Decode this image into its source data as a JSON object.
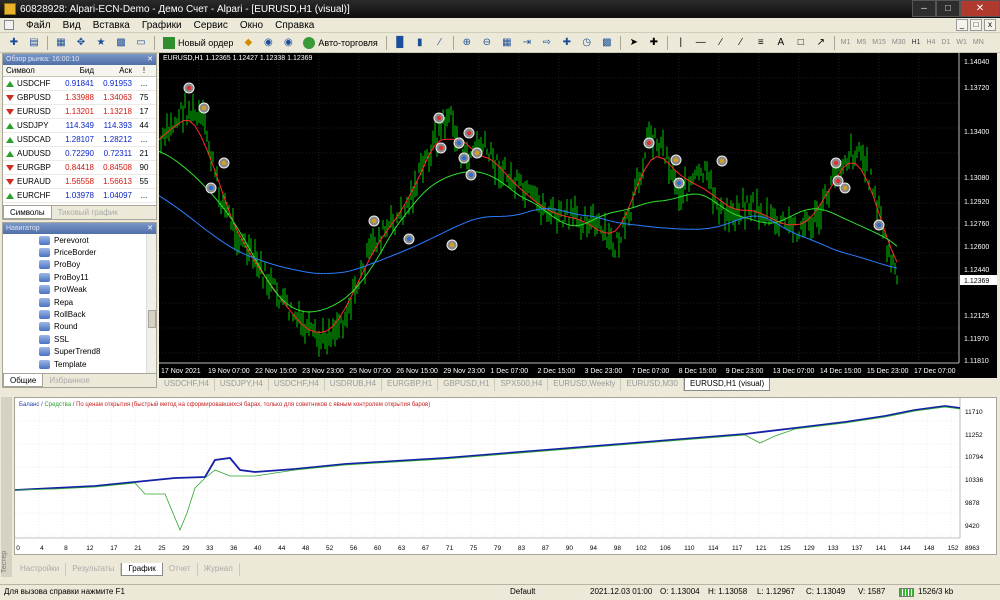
{
  "window": {
    "title": "60828928: Alpari-ECN-Demo - Демо Счет - Alpari - [EURUSD,H1 (visual)]"
  },
  "menu": [
    "Файл",
    "Вид",
    "Вставка",
    "Графики",
    "Сервис",
    "Окно",
    "Справка"
  ],
  "toolbar": {
    "new_order_label": "Новый ордер",
    "autotrading_label": "Авто-торговля",
    "timeframes": [
      "M1",
      "M5",
      "M15",
      "M30",
      "H1",
      "H4",
      "D1",
      "W1",
      "MN"
    ],
    "active_timeframe": "H1"
  },
  "market_watch": {
    "title": "Обзор рынка: 16:00:10",
    "headers": {
      "symbol": "Символ",
      "bid": "Бид",
      "ask": "Аск",
      "spread": "!"
    },
    "rows": [
      {
        "symbol": "USDCHF",
        "bid": "0.91841",
        "ask": "0.91953",
        "spread": "...",
        "dir": "up"
      },
      {
        "symbol": "GBPUSD",
        "bid": "1.33988",
        "ask": "1.34063",
        "spread": "75",
        "dir": "down"
      },
      {
        "symbol": "EURUSD",
        "bid": "1.13201",
        "ask": "1.13218",
        "spread": "17",
        "dir": "down"
      },
      {
        "symbol": "USDJPY",
        "bid": "114.349",
        "ask": "114.393",
        "spread": "44",
        "dir": "up"
      },
      {
        "symbol": "USDCAD",
        "bid": "1.28107",
        "ask": "1.28212",
        "spread": "...",
        "dir": "up"
      },
      {
        "symbol": "AUDUSD",
        "bid": "0.72290",
        "ask": "0.72311",
        "spread": "21",
        "dir": "up"
      },
      {
        "symbol": "EURGBP",
        "bid": "0.84418",
        "ask": "0.84508",
        "spread": "90",
        "dir": "down"
      },
      {
        "symbol": "EURAUD",
        "bid": "1.56558",
        "ask": "1.56613",
        "spread": "55",
        "dir": "down"
      },
      {
        "symbol": "EURCHF",
        "bid": "1.03978",
        "ask": "1.04097",
        "spread": "...",
        "dir": "up"
      }
    ],
    "tabs": [
      "Символы",
      "Тиковый график"
    ],
    "active_tab": "Символы"
  },
  "navigator": {
    "title": "Навигатор",
    "items": [
      "Perevorot",
      "PriceBorder",
      "ProBoy",
      "ProBoy11",
      "ProWeak",
      "Repa",
      "RollBack",
      "Round",
      "SSL",
      "SuperTrend8",
      "Template"
    ],
    "tabs": [
      "Общие",
      "Избранное"
    ],
    "active_tab": "Общие"
  },
  "chart": {
    "info": "EURUSD,H1  1.12365 1.12427 1.12338 1.12369",
    "price_labels": [
      "1.14040",
      "1.13720",
      "1.13400",
      "1.13080",
      "1.12920",
      "1.12760",
      "1.12600",
      "1.12440",
      "1.12125",
      "1.11970",
      "1.11810"
    ],
    "current_price": "1.12369",
    "time_labels": [
      "17 Nov 2021",
      "19 Nov 07:00",
      "22 Nov 15:00",
      "23 Nov 23:00",
      "25 Nov 07:00",
      "26 Nov 15:00",
      "29 Nov 23:00",
      "1 Dec 07:00",
      "2 Dec 15:00",
      "3 Dec 23:00",
      "7 Dec 07:00",
      "8 Dec 15:00",
      "9 Dec 23:00",
      "13 Dec 07:00",
      "14 Dec 15:00",
      "15 Dec 23:00",
      "17 Dec 07:00"
    ],
    "colors": {
      "bg": "#000000",
      "candles": "#00c800",
      "ma_red": "#ff2a2a",
      "ma_green": "#2ee02e",
      "ma_blue": "#2b7cff",
      "grid": "#3a3a3a"
    }
  },
  "chart_tabs": [
    "USDCHF,H4",
    "USDJPY,H4",
    "USDCHF,H4",
    "USDRUB,H4",
    "EURGBP,H1",
    "GBPUSD,H1",
    "SPX500,H4",
    "EURUSD,Weekly",
    "EURUSD,M30",
    "EURUSD,H1 (visual)"
  ],
  "active_chart_tab": "EURUSD,H1 (visual)",
  "tester_graph": {
    "legend_balance": "Баланс",
    "legend_equity": "Средства",
    "legend_rest": "По ценам открытия (быстрый метод на сформировавшихся барах, только для советников с явным контролем открытия баров)",
    "y_labels": [
      "11710",
      "11252",
      "10794",
      "10336",
      "9878",
      "9420",
      "8963"
    ],
    "x_labels": [
      "0",
      "4",
      "8",
      "12",
      "17",
      "21",
      "25",
      "29",
      "33",
      "36",
      "40",
      "44",
      "48",
      "52",
      "56",
      "60",
      "63",
      "67",
      "71",
      "75",
      "79",
      "83",
      "87",
      "90",
      "94",
      "98",
      "102",
      "106",
      "110",
      "114",
      "117",
      "121",
      "125",
      "129",
      "133",
      "137",
      "141",
      "144",
      "148",
      "152"
    ],
    "side_label": "Тестер"
  },
  "tester_tabs": [
    "Настройки",
    "Результаты",
    "График",
    "Отчет",
    "Журнал"
  ],
  "active_tester_tab": "График",
  "status": {
    "help": "Для вызова справки нажмите F1",
    "profile": "Default",
    "datetime": "2021.12.03 01:00",
    "open": "O: 1.13004",
    "high": "H: 1.13058",
    "low": "L: 1.12967",
    "close": "C: 1.13049",
    "volume": "V: 1587",
    "traffic": "1526/3 kb"
  }
}
